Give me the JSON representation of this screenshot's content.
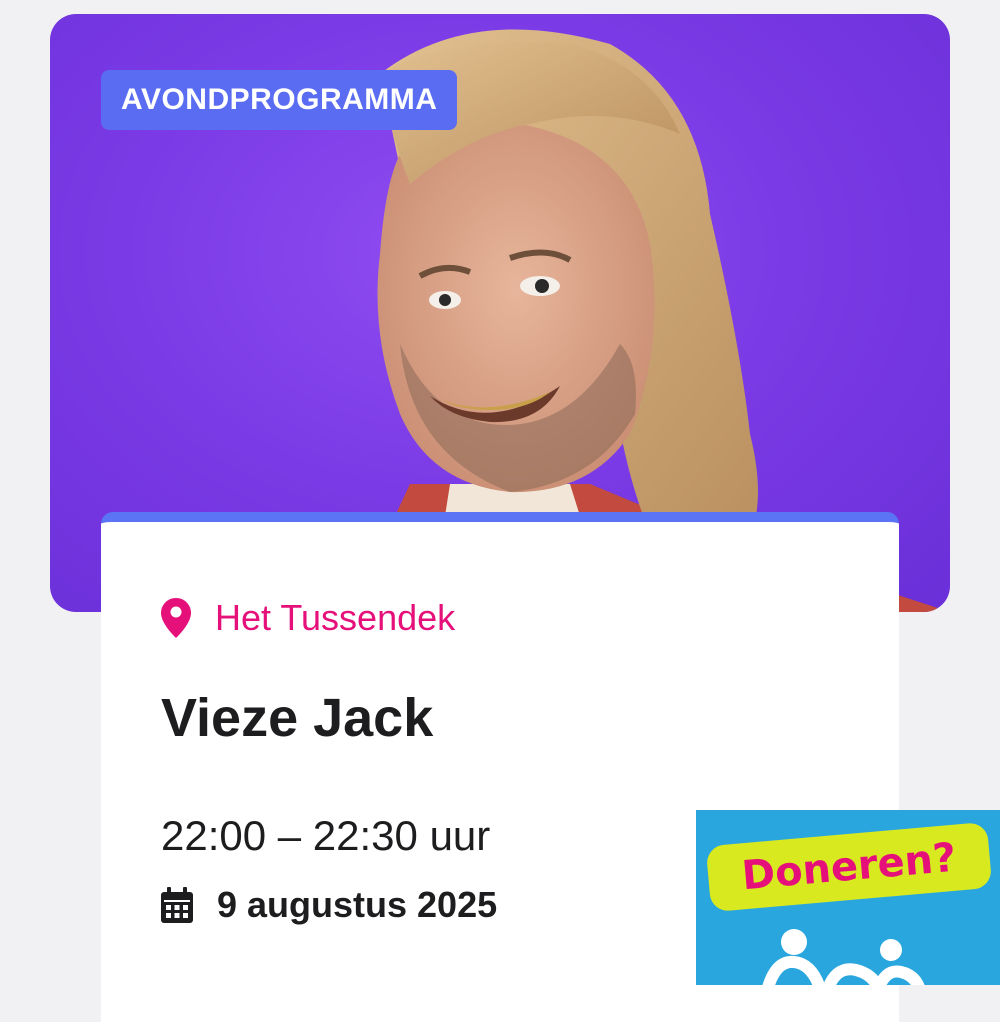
{
  "event": {
    "category_tag": "AVONDPROGRAMMA",
    "location": "Het Tussendek",
    "title": "Vieze Jack",
    "time": "22:00 – 22:30 uur",
    "date": "9 augustus 2025"
  },
  "donate_widget": {
    "label": "Doneren?"
  },
  "colors": {
    "hero_background": "#7b3be6",
    "tag_background": "#5a6cf2",
    "card_accent": "#5b73f5",
    "location_color": "#e6107a",
    "donate_background": "#2aa6de",
    "donate_pill": "#d8ea1f"
  },
  "icons": {
    "location": "map-pin-icon",
    "date": "calendar-icon",
    "donate_logo": "people-logo-icon"
  }
}
